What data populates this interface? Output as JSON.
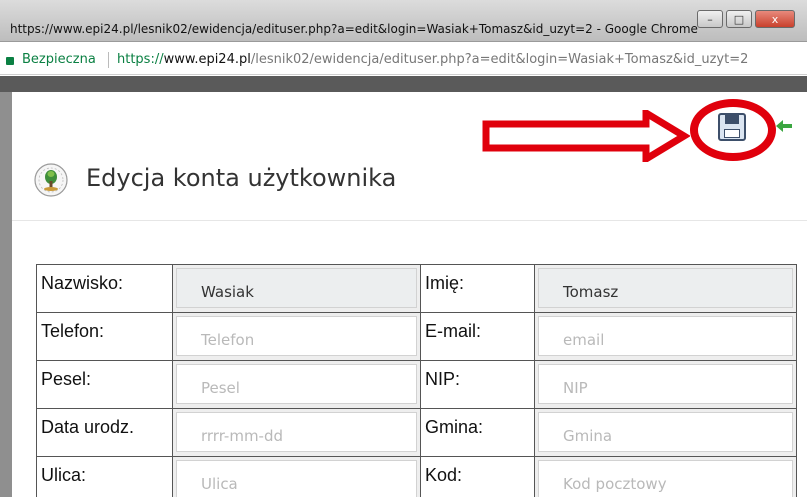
{
  "window": {
    "title": "https://www.epi24.pl/lesnik02/ewidencja/edituser.php?a=edit&login=Wasiak+Tomasz&id_uzyt=2 - Google Chrome",
    "buttons": {
      "minimize": "–",
      "maximize": "□",
      "close": "x"
    }
  },
  "addressbar": {
    "secure_label": "Bezpieczna",
    "url_scheme": "https://",
    "url_host": "www.epi24.pl",
    "url_path": "/lesnik02/ewidencja/edituser.php?a=edit&login=Wasiak+Tomasz&id_uzyt=2"
  },
  "page": {
    "title": "Edycja konta użytkownika"
  },
  "icons": {
    "save": "save-icon",
    "back": "back-arrow-icon",
    "logo": "app-logo-icon"
  },
  "annotation_color": "#e0000c",
  "form": {
    "rows": [
      {
        "label1": "Nazwisko:",
        "value1": "Wasiak",
        "placeholder1": "",
        "label2": "Imię:",
        "value2": "Tomasz",
        "placeholder2": ""
      },
      {
        "label1": "Telefon:",
        "value1": "",
        "placeholder1": "Telefon",
        "label2": "E-mail:",
        "value2": "",
        "placeholder2": "email"
      },
      {
        "label1": "Pesel:",
        "value1": "",
        "placeholder1": "Pesel",
        "label2": "NIP:",
        "value2": "",
        "placeholder2": "NIP"
      },
      {
        "label1": "Data urodz.",
        "value1": "",
        "placeholder1": "rrrr-mm-dd",
        "label2": "Gmina:",
        "value2": "",
        "placeholder2": "Gmina"
      },
      {
        "label1": "Ulica:",
        "value1": "",
        "placeholder1": "Ulica",
        "label2": "Kod:",
        "value2": "",
        "placeholder2": "Kod pocztowy"
      }
    ]
  }
}
